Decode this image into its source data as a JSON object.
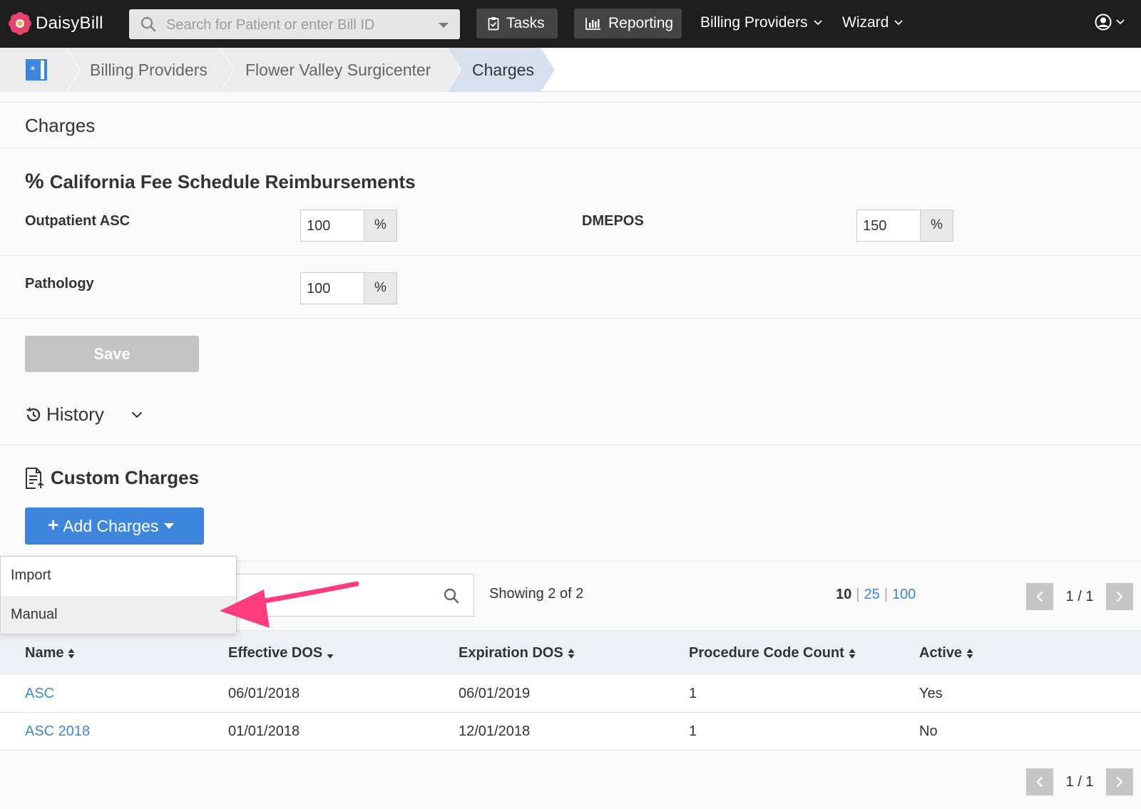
{
  "nav": {
    "brand": "DaisyBill",
    "search_placeholder": "Search for Patient or enter Bill ID",
    "tasks": "Tasks",
    "reporting": "Reporting",
    "billing_providers": "Billing Providers",
    "wizard": "Wizard"
  },
  "breadcrumb": {
    "items": [
      "Billing Providers",
      "Flower Valley Surgicenter",
      "Charges"
    ]
  },
  "page": {
    "title": "Charges"
  },
  "fee_schedule": {
    "title": "California Fee Schedule Reimbursements",
    "fields": [
      {
        "label": "Outpatient ASC",
        "value": "100",
        "unit": "%"
      },
      {
        "label": "DMEPOS",
        "value": "150",
        "unit": "%"
      },
      {
        "label": "Pathology",
        "value": "100",
        "unit": "%"
      }
    ],
    "save_label": "Save"
  },
  "history": {
    "label": "History"
  },
  "custom_charges": {
    "title": "Custom Charges",
    "add_label": "Add Charges",
    "menu": [
      "Import",
      "Manual"
    ]
  },
  "list": {
    "showing": "Showing 2 of 2",
    "page_sizes": [
      "10",
      "25",
      "100"
    ],
    "current_page_size": "10",
    "page_info": "1 / 1",
    "columns": [
      "Name",
      "Effective DOS",
      "Expiration DOS",
      "Procedure Code Count",
      "Active"
    ],
    "rows": [
      {
        "name": "ASC",
        "effective": "06/01/2018",
        "expiration": "06/01/2019",
        "count": "1",
        "active": "Yes"
      },
      {
        "name": "ASC 2018",
        "effective": "01/01/2018",
        "expiration": "12/01/2018",
        "count": "1",
        "active": "No"
      }
    ]
  },
  "colors": {
    "nav_bg": "#1e1e1e",
    "primary": "#3e86dd",
    "annotation": "#ff3c7e",
    "disabled": "#c3c3c3"
  }
}
